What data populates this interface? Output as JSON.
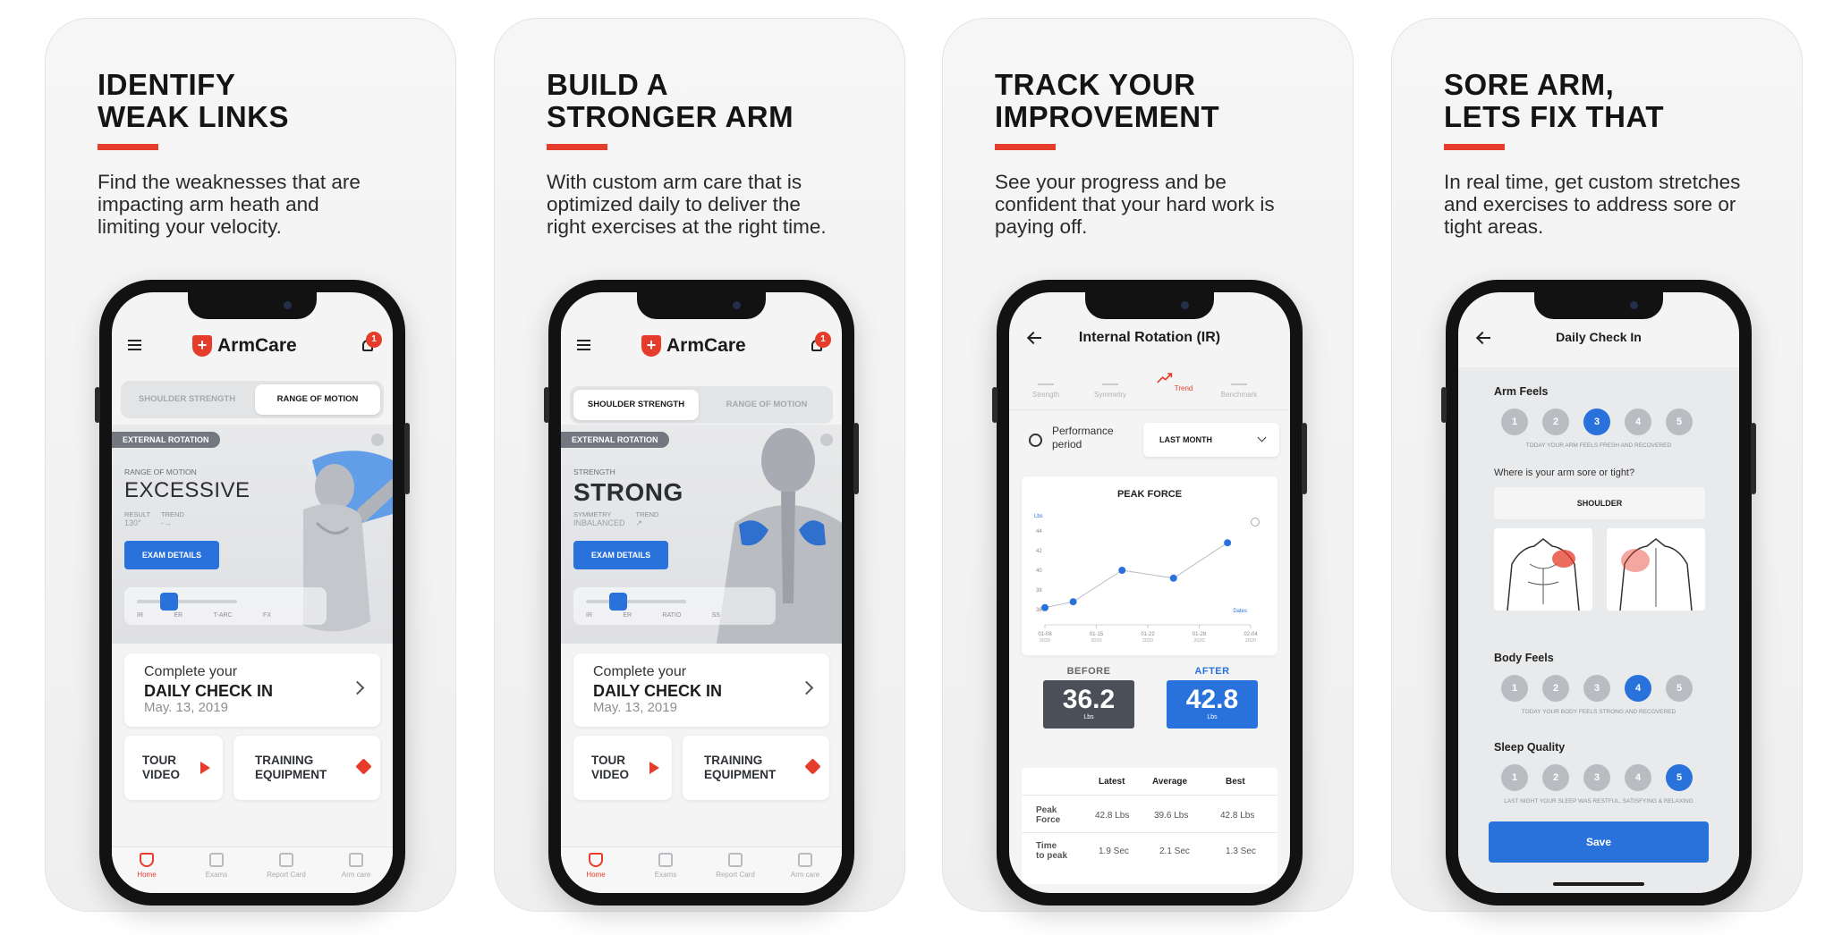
{
  "cards": [
    {
      "title_lines": [
        "IDENTIFY",
        "WEAK LINKS"
      ],
      "desc_lines": [
        "Find the weaknesses that are",
        "impacting arm heath and",
        "limiting your velocity."
      ]
    },
    {
      "title_lines": [
        "BUILD A",
        "STRONGER ARM"
      ],
      "desc_lines": [
        "With custom arm care that is",
        "optimized daily to deliver the",
        "right exercises at the right time."
      ]
    },
    {
      "title_lines": [
        "TRACK YOUR",
        "IMPROVEMENT"
      ],
      "desc_lines": [
        "See your progress and be",
        "confident that your hard work is",
        "paying off."
      ]
    },
    {
      "title_lines": [
        "SORE ARM,",
        "LETS FIX THAT"
      ],
      "desc_lines": [
        "In real time, get custom stretches",
        "and exercises to address sore or",
        "tight areas."
      ]
    }
  ],
  "home": {
    "brand": "ArmCare",
    "notification_count": "1",
    "segment_tabs": [
      "SHOULDER STRENGTH",
      "RANGE OF MOTION"
    ],
    "screen1": {
      "pill": "EXTERNAL ROTATION",
      "kicker": "RANGE OF MOTION",
      "big_word": "EXCESSIVE",
      "label_a": "RESULT",
      "value_a": "130°",
      "label_b": "TREND",
      "value_b": "-→",
      "button": "EXAM DETAILS",
      "slider_labels": [
        "IR",
        "ER",
        "T-ARC",
        "FX"
      ]
    },
    "screen2": {
      "pill": "EXTERNAL ROTATION",
      "kicker": "STRENGTH",
      "big_word": "STRONG",
      "label_a": "SYMMETRY",
      "value_a": "INBALANCED",
      "label_b": "TREND",
      "value_b": "↗",
      "button": "EXAM DETAILS",
      "slider_labels": [
        "IR",
        "ER",
        "RATIO",
        "SS"
      ]
    },
    "checkin": {
      "line1": "Complete your",
      "line2": "DAILY CHECK IN",
      "line3": "May. 13, 2019"
    },
    "tile_tour": [
      "TOUR",
      "VIDEO"
    ],
    "tile_equipment": [
      "TRAINING",
      "EQUIPMENT"
    ],
    "tabbar": [
      "Home",
      "Exams",
      "Report Card",
      "Arm care"
    ],
    "colors": {
      "accent_red": "#e63c2b",
      "accent_blue": "#2a72db"
    }
  },
  "trend": {
    "title": "Internal Rotation (IR)",
    "subtabs": [
      "Strength",
      "Symmetry",
      "Trend",
      "Benchmark"
    ],
    "period_label": [
      "Performance",
      "period"
    ],
    "period_value": "LAST MONTH",
    "before_label": "BEFORE",
    "before_value": "36.2",
    "before_unit": "Lbs",
    "after_label": "AFTER",
    "after_value": "42.8",
    "after_unit": "Lbs",
    "table": {
      "headers": [
        "Latest",
        "Average",
        "Best"
      ],
      "rows": [
        {
          "label": [
            "Peak",
            "Force"
          ],
          "values": [
            "42.8 Lbs",
            "39.6 Lbs",
            "42.8 Lbs"
          ]
        },
        {
          "label": [
            "Time",
            "to peak"
          ],
          "values": [
            "1.9 Sec",
            "2.1 Sec",
            "1.3 Sec"
          ]
        }
      ]
    }
  },
  "chart_data": {
    "type": "line",
    "title": "PEAK FORCE",
    "ylabel": "Lbs",
    "xlabel": "Dates",
    "x": [
      "01-08 2020",
      "01-15 2020",
      "01-22 2020",
      "01-28 2020",
      "02-04 2020"
    ],
    "x_ticks": [
      [
        "01-08",
        "2020"
      ],
      [
        "01-15",
        "2020"
      ],
      [
        "01-22",
        "2020"
      ],
      [
        "01-28",
        "2020"
      ],
      [
        "02-04",
        "2020"
      ]
    ],
    "y_ticks": [
      "36",
      "38",
      "40",
      "42",
      "44"
    ],
    "ylim": [
      35,
      45
    ],
    "points": [
      {
        "x": 0,
        "y": 36.2
      },
      {
        "x": 0.55,
        "y": 36.8
      },
      {
        "x": 1.5,
        "y": 40.0
      },
      {
        "x": 2.5,
        "y": 39.2
      },
      {
        "x": 3.55,
        "y": 42.8
      }
    ],
    "xlim": [
      0,
      4
    ],
    "series": [
      {
        "values": [
          36.2,
          36.8,
          40.0,
          39.2,
          42.8
        ]
      }
    ],
    "grid": false
  },
  "checkin_screen": {
    "title": "Daily Check In",
    "arm_feels": "Arm Feels",
    "arm_caption": "TODAY YOUR ARM FEELS FRESH AND RECOVERED",
    "sore_question": "Where is your arm sore or tight?",
    "sore_value": "SHOULDER",
    "body_feels": "Body Feels",
    "body_caption": "TODAY YOUR BODY FEELS STRONG AND RECOVERED",
    "sleep_quality": "Sleep Quality",
    "sleep_caption": "LAST NIGHT YOUR SLEEP WAS RESTFUL, SATISFYING & RELAXING",
    "scale": [
      "1",
      "2",
      "3",
      "4",
      "5"
    ],
    "arm_selected": 3,
    "body_selected": 4,
    "sleep_selected": 5,
    "save": "Save"
  }
}
